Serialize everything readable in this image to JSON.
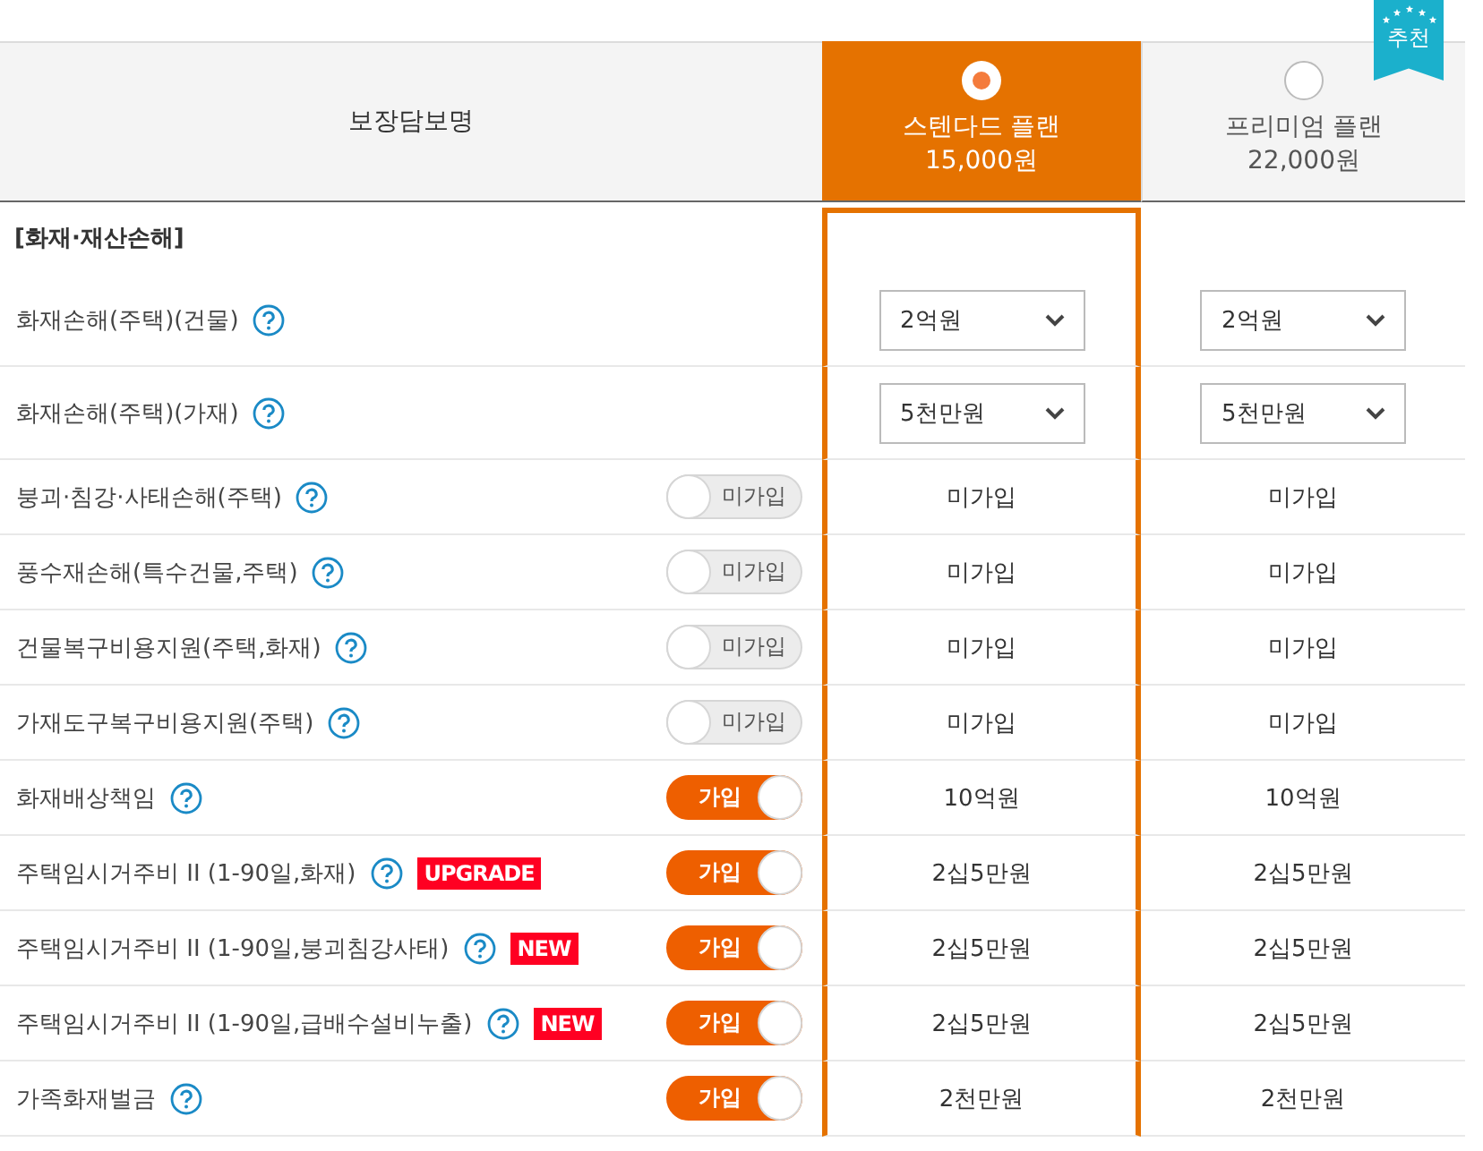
{
  "header": {
    "coverage_label": "보장담보명"
  },
  "plans": [
    {
      "name": "스텐다드 플랜",
      "price": "15,000원",
      "selected": true,
      "recommended": false
    },
    {
      "name": "프리미엄 플랜",
      "price": "22,000원",
      "selected": false,
      "recommended": true,
      "ribbon": "추천"
    }
  ],
  "section": "[화재·재산손해]",
  "rows": [
    {
      "kind": "select",
      "name": "화재손해(주택)(건물)",
      "values": [
        "2억원",
        "2억원"
      ]
    },
    {
      "kind": "select",
      "name": "화재손해(주택)(가재)",
      "values": [
        "5천만원",
        "5천만원"
      ]
    },
    {
      "kind": "toggle",
      "name": "붕괴·침강·사태손해(주택)",
      "joined": false,
      "toggle_label": "미가입",
      "values": [
        "미가입",
        "미가입"
      ]
    },
    {
      "kind": "toggle",
      "name": "풍수재손해(특수건물,주택)",
      "joined": false,
      "toggle_label": "미가입",
      "values": [
        "미가입",
        "미가입"
      ]
    },
    {
      "kind": "toggle",
      "name": "건물복구비용지원(주택,화재)",
      "joined": false,
      "toggle_label": "미가입",
      "values": [
        "미가입",
        "미가입"
      ]
    },
    {
      "kind": "toggle",
      "name": "가재도구복구비용지원(주택)",
      "joined": false,
      "toggle_label": "미가입",
      "values": [
        "미가입",
        "미가입"
      ]
    },
    {
      "kind": "toggle",
      "name": "화재배상책임",
      "joined": true,
      "toggle_label": "가입",
      "values": [
        "10억원",
        "10억원"
      ]
    },
    {
      "kind": "toggle",
      "name": "주택임시거주비 II (1-90일,화재)",
      "badge": "UPGRADE",
      "joined": true,
      "toggle_label": "가입",
      "values": [
        "2십5만원",
        "2십5만원"
      ]
    },
    {
      "kind": "toggle",
      "name": "주택임시거주비 II (1-90일,붕괴침강사태)",
      "badge": "NEW",
      "joined": true,
      "toggle_label": "가입",
      "values": [
        "2십5만원",
        "2십5만원"
      ]
    },
    {
      "kind": "toggle",
      "name": "주택임시거주비 II (1-90일,급배수설비누출)",
      "badge": "NEW",
      "joined": true,
      "toggle_label": "가입",
      "values": [
        "2십5만원",
        "2십5만원"
      ]
    },
    {
      "kind": "toggle",
      "name": "가족화재벌금",
      "joined": true,
      "toggle_label": "가입",
      "values": [
        "2천만원",
        "2천만원"
      ]
    }
  ]
}
